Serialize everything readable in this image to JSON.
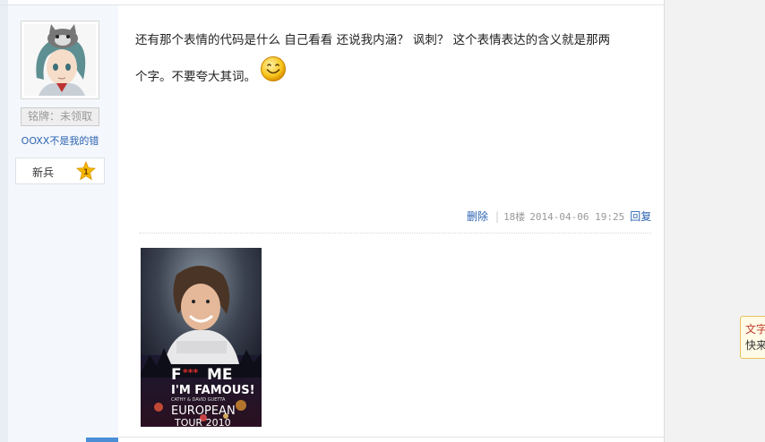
{
  "user": {
    "badge_label": "铭牌：未领取",
    "username": "OOXX不是我的错",
    "level_title": "新兵",
    "level_number": "1"
  },
  "post": {
    "line1": "还有那个表情的代码是什么  自己看看  还说我内涵？  讽刺？  这个表情表达的含义就是那两",
    "line2": "个字。不要夸大其词。",
    "smiley_icon": "smiley-emoticon"
  },
  "meta": {
    "delete_label": "删除",
    "floor": "18楼",
    "timestamp": "2014-04-06 19:25",
    "reply_label": "回复"
  },
  "poster": {
    "line1": "F",
    "stars": "***",
    "line1b": "ME",
    "line2": "I'M FAMOUS!",
    "line3": "CATHY & DAVID GUETTA",
    "line4": "EUROPEAN",
    "line5": "TOUR 2010"
  },
  "floating_tip": {
    "line1": "文字",
    "line2": "快来"
  },
  "colors": {
    "link": "#2d64b3",
    "sidebar_bg": "#f4f7fb",
    "star": "#f5b800"
  }
}
